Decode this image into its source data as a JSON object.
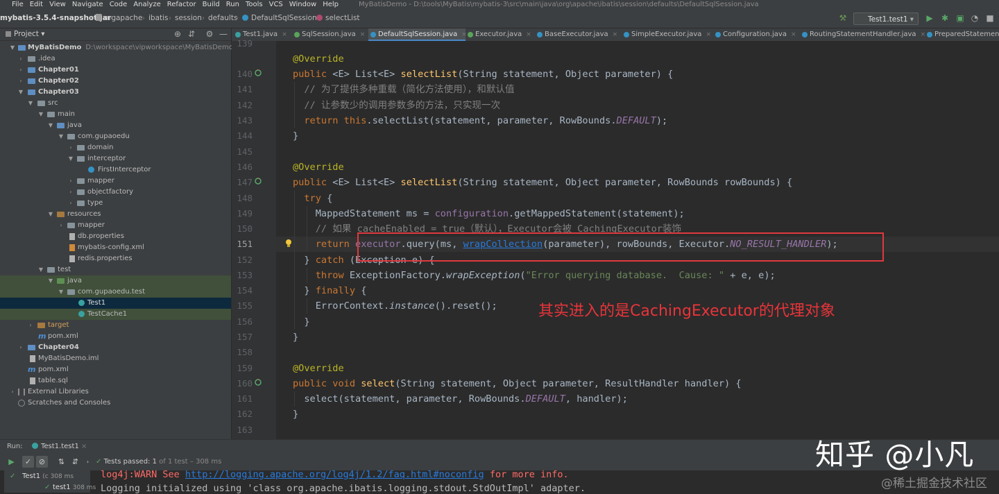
{
  "menu": {
    "items": [
      "File",
      "Edit",
      "View",
      "Navigate",
      "Code",
      "Analyze",
      "Refactor",
      "Build",
      "Run",
      "Tools",
      "VCS",
      "Window",
      "Help"
    ],
    "title": "MyBatisDemo - D:\\tools\\MyBatis\\mybatis-3\\src\\main\\java\\org\\apache\\ibatis\\session\\defaults\\DefaultSqlSession.java"
  },
  "breadcrumb": [
    "mybatis-3.5.4-snapshot.jar",
    "org",
    "apache",
    "ibatis",
    "session",
    "defaults",
    "DefaultSqlSession",
    "selectList"
  ],
  "run_config": "Test1.test1",
  "project_panel": {
    "title": "Project"
  },
  "tree": [
    {
      "label": "MyBatisDemo",
      "path": "D:\\workspace\\vipworkspace\\MyBatisDemo"
    },
    {
      "label": ".idea"
    },
    {
      "label": "Chapter01"
    },
    {
      "label": "Chapter02"
    },
    {
      "label": "Chapter03"
    },
    {
      "label": "src"
    },
    {
      "label": "main"
    },
    {
      "label": "java"
    },
    {
      "label": "com.gupaoedu"
    },
    {
      "label": "domain"
    },
    {
      "label": "interceptor"
    },
    {
      "label": "FirstInterceptor"
    },
    {
      "label": "mapper"
    },
    {
      "label": "objectfactory"
    },
    {
      "label": "type"
    },
    {
      "label": "resources"
    },
    {
      "label": "mapper"
    },
    {
      "label": "db.properties"
    },
    {
      "label": "mybatis-config.xml"
    },
    {
      "label": "redis.properties"
    },
    {
      "label": "test"
    },
    {
      "label": "java"
    },
    {
      "label": "com.gupaoedu.test"
    },
    {
      "label": "Test1"
    },
    {
      "label": "TestCache1"
    },
    {
      "label": "target"
    },
    {
      "label": "pom.xml"
    },
    {
      "label": "Chapter04"
    },
    {
      "label": "MyBatisDemo.iml"
    },
    {
      "label": "pom.xml"
    },
    {
      "label": "table.sql"
    },
    {
      "label": "External Libraries"
    },
    {
      "label": "Scratches and Consoles"
    }
  ],
  "tabs": [
    "Test1.java",
    "SqlSession.java",
    "DefaultSqlSession.java",
    "Executor.java",
    "BaseExecutor.java",
    "SimpleExecutor.java",
    "Configuration.java",
    "RoutingStatementHandler.java",
    "PreparedStatementHandler.java"
  ],
  "line_numbers": [
    "139",
    "140",
    "141",
    "142",
    "143",
    "144",
    "145",
    "146",
    "147",
    "148",
    "149",
    "150",
    "151",
    "152",
    "153",
    "154",
    "155",
    "156",
    "157",
    "158",
    "159",
    "160",
    "161",
    "162",
    "163"
  ],
  "annotation": "其实进入的是CachingExecutor的代理对象",
  "watermark": {
    "main": "知乎 @小凡",
    "sub": "@稀土掘金技术社区"
  },
  "run": {
    "label": "Run:",
    "config_tab": "Test1.test1",
    "tests_passed": "Tests passed: 1",
    "tests_detail": "of 1 test – 308 ms",
    "tree_items": [
      {
        "label": "Test1",
        "time": "(c 308 ms"
      },
      {
        "label": "test1",
        "time": "308 ms"
      }
    ],
    "console": {
      "l1_a": "log4j:WARN See ",
      "l1_link": "http://logging.apache.org/log4j/1.2/faq.html#noconfig",
      "l1_b": " for more info.",
      "l2": "Logging initialized using 'class org.apache.ibatis.logging.stdout.StdOutImpl' adapter."
    }
  }
}
